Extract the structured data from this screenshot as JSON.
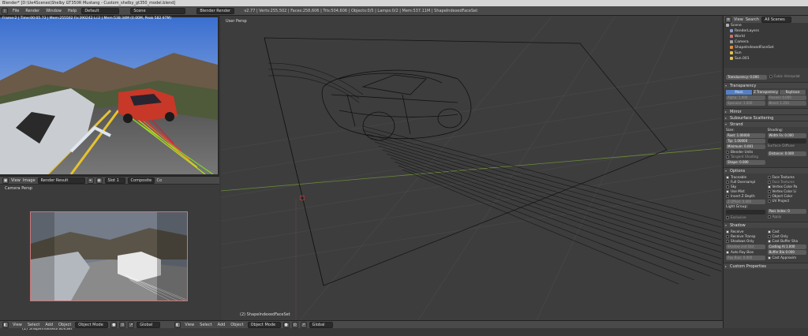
{
  "window": {
    "title": "Blender* [D:\\Ue4Scenes\\Shelby GT350R Mustang - Custom_shelby_gt350_model.blend]"
  },
  "topbar": {
    "menus": [
      "File",
      "Render",
      "Window",
      "Help"
    ],
    "layout": "Default",
    "scene": "Scene",
    "engine": "Blender Render",
    "stats": "v2.77 | Verts:255,502 | Faces:258,606 | Tris:504,606 | Objects:0/5 | Lamps:0/2 | Mem:537.11M | ShapeIndexedFaceSet"
  },
  "left": {
    "render_info": "Frame:2 | Time:00:05.73 | Mem:255502 Fa:390242 Li:2 | Mem:538.34M (0.00M, Peak 582.97M)",
    "image_header": {
      "view": "View",
      "image": "Image",
      "slot_name": "Render Result",
      "slot": "Slot 1",
      "pass": "Composite",
      "extra": "Co"
    },
    "camview_label": "Camera Persp",
    "camview_object": "(2) ShapeIndexedFaceSet"
  },
  "viewport": {
    "label": "User Persp",
    "object_label": "(2) ShapeIndexedFaceSet"
  },
  "bottombar": {
    "left": {
      "menus": [
        "View",
        "Select",
        "Add",
        "Object"
      ],
      "mode": "Object Mode",
      "orientation": "Global"
    },
    "right": {
      "menus": [
        "View",
        "Select",
        "Add",
        "Object"
      ],
      "mode": "Object Mode",
      "orientation": "Global"
    }
  },
  "outliner": {
    "menus": [
      "View",
      "Search"
    ],
    "filter": "All Scenes",
    "items": [
      {
        "name": "Scene",
        "color": "#b0b0b0"
      },
      {
        "name": "RenderLayers",
        "color": "#8a9bd0"
      },
      {
        "name": "World",
        "color": "#d07070"
      },
      {
        "name": "Camera",
        "color": "#a0a0a0"
      },
      {
        "name": "ShapeIndexedFaceSet",
        "color": "#e09040"
      },
      {
        "name": "Sun",
        "color": "#e0c050"
      },
      {
        "name": "Sun.001",
        "color": "#e0c050"
      }
    ]
  },
  "props": {
    "translucency": {
      "label": "Translucency:",
      "value": "0.000",
      "cubic": "Cubic Interpolat"
    },
    "transparency": {
      "title": "Transparency",
      "modes": [
        "Mask",
        "Z Transparency",
        "Raytrace"
      ],
      "alpha": "Alpha: 1.000",
      "specular": "Specular: 1.000",
      "fresnel": "Fresnel: 0.000",
      "blend": "Blend: 1.250"
    },
    "mirror": "Mirror",
    "sss": "Subsurface Scattering",
    "strand": {
      "title": "Strand",
      "size": "Size:",
      "shading": "Shading:",
      "root": "Root: 1.00000",
      "tip": "Tip: 1.00000",
      "min": "Minimum: 0.001",
      "width_fade": "Width Fa: 0.000",
      "blender_units": "Blender Units",
      "tangent": "Tangent Shading",
      "surface_diffuse": "Surface Diffuse",
      "distance": "Distance: 0.000",
      "shape": "Shape: 0.000"
    },
    "options": {
      "title": "Options",
      "items_left": [
        "Traceable",
        "Full Oversampl",
        "Sky",
        "Use Mist",
        "Invert Z Depth",
        "Z Offset: 0.000"
      ],
      "items_right": [
        "Face Textures",
        "Face Textures",
        "Vertex Color Pa",
        "Vertex Color Li",
        "Object Color",
        "UV Project"
      ],
      "light_group": "Light Group:",
      "pass_index": "Pass Index: 0",
      "exclusive": "Exclusive",
      "apply": "Apply"
    },
    "shadow": {
      "title": "Shadow",
      "items_left": [
        "Receive",
        "Receive Transp",
        "Shadows Only",
        "Shadow and Dist",
        "Auto Ray Bias",
        "Ray Bias: 0.000"
      ],
      "items_right": [
        "Cast",
        "Cast Only",
        "Cast Buffer Sha",
        "Casting Al 1.000",
        "Buffer Bia 0.000",
        "Cast Approxim"
      ]
    },
    "custom": "Custom Properties"
  }
}
